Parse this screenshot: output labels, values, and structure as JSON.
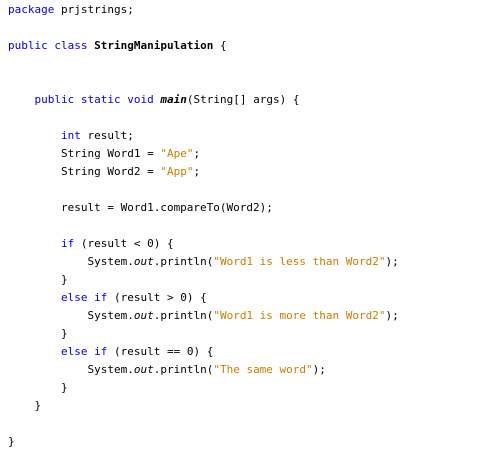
{
  "code": {
    "lines": [
      [
        {
          "t": "package",
          "c": "kw"
        },
        {
          "t": " prjstrings;"
        }
      ],
      [],
      [
        {
          "t": "public",
          "c": "kw"
        },
        {
          "t": " "
        },
        {
          "t": "class",
          "c": "kw"
        },
        {
          "t": " "
        },
        {
          "t": "StringManipulation",
          "c": "bold"
        },
        {
          "t": " {"
        }
      ],
      [],
      [],
      [
        {
          "t": "    "
        },
        {
          "t": "public",
          "c": "kw"
        },
        {
          "t": " "
        },
        {
          "t": "static",
          "c": "kw"
        },
        {
          "t": " "
        },
        {
          "t": "void",
          "c": "kw"
        },
        {
          "t": " "
        },
        {
          "t": "main",
          "c": "boldit"
        },
        {
          "t": "(String[] args) {"
        }
      ],
      [],
      [
        {
          "t": "        "
        },
        {
          "t": "int",
          "c": "kw"
        },
        {
          "t": " result;"
        }
      ],
      [
        {
          "t": "        String Word1 = "
        },
        {
          "t": "\"Ape\"",
          "c": "str"
        },
        {
          "t": ";"
        }
      ],
      [
        {
          "t": "        String Word2 = "
        },
        {
          "t": "\"App\"",
          "c": "str"
        },
        {
          "t": ";"
        }
      ],
      [],
      [
        {
          "t": "        result = Word1.compareTo(Word2);"
        }
      ],
      [],
      [
        {
          "t": "        "
        },
        {
          "t": "if",
          "c": "kw"
        },
        {
          "t": " (result < 0) {"
        }
      ],
      [
        {
          "t": "            System."
        },
        {
          "t": "out",
          "c": "it"
        },
        {
          "t": ".println("
        },
        {
          "t": "\"Word1 is less than Word2\"",
          "c": "str"
        },
        {
          "t": ");"
        }
      ],
      [
        {
          "t": "        }"
        }
      ],
      [
        {
          "t": "        "
        },
        {
          "t": "else",
          "c": "kw"
        },
        {
          "t": " "
        },
        {
          "t": "if",
          "c": "kw"
        },
        {
          "t": " (result > 0) {"
        }
      ],
      [
        {
          "t": "            System."
        },
        {
          "t": "out",
          "c": "it"
        },
        {
          "t": ".println("
        },
        {
          "t": "\"Word1 is more than Word2\"",
          "c": "str"
        },
        {
          "t": ");"
        }
      ],
      [
        {
          "t": "        }"
        }
      ],
      [
        {
          "t": "        "
        },
        {
          "t": "else",
          "c": "kw"
        },
        {
          "t": " "
        },
        {
          "t": "if",
          "c": "kw"
        },
        {
          "t": " (result == 0) {"
        }
      ],
      [
        {
          "t": "            System."
        },
        {
          "t": "out",
          "c": "it"
        },
        {
          "t": ".println("
        },
        {
          "t": "\"The same word\"",
          "c": "str"
        },
        {
          "t": ");"
        }
      ],
      [
        {
          "t": "        }"
        }
      ],
      [
        {
          "t": "    }"
        }
      ],
      [],
      [
        {
          "t": "}"
        }
      ]
    ]
  },
  "colors": {
    "keyword": "#0000e6",
    "string": "#ce7b00",
    "text": "#000000",
    "background": "#ffffff"
  }
}
